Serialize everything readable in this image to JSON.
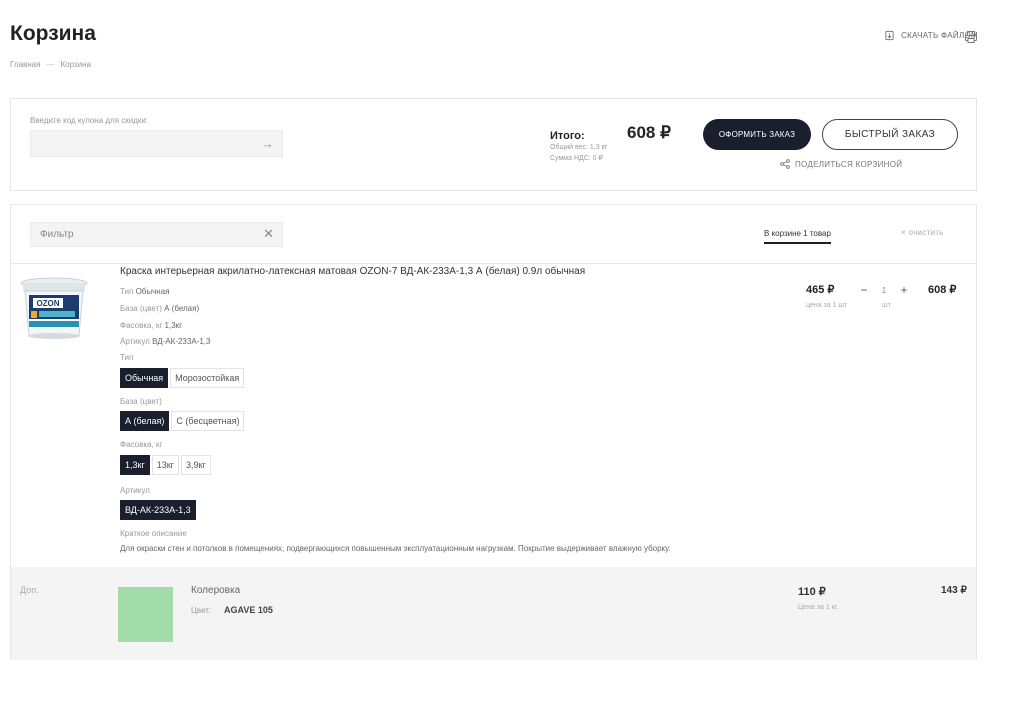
{
  "page": {
    "title": "Корзина",
    "breadcrumb": [
      "Главная",
      "Корзина"
    ],
    "breadcrumb_sep": "—",
    "download_label": "Скачать файлом"
  },
  "coupon": {
    "label": "Введите код купона для скидки:",
    "value": "",
    "arrow_icon": "arrow-right-icon"
  },
  "summary": {
    "total_label": "Итого:",
    "total_value": "608 ₽",
    "weight": "Общий вес: 1,3 кг",
    "vat": "Сумма НДС: 0 ₽",
    "order_button": "Оформить заказ",
    "quick_order_button": "Быстрый заказ",
    "share_label": "Поделиться корзиной"
  },
  "cart": {
    "filter_placeholder": "Фильтр",
    "count_label": "В корзине 1 товар",
    "clear_label": "× очистить",
    "clear_icon": "close-icon"
  },
  "product": {
    "name": "Краска интерьерная акрилатно-латексная матовая OZON-7 ВД-АК-233А-1,3 А (белая) 0.9л обычная",
    "brand_on_image": "OZON",
    "specs": [
      {
        "label": "Тип",
        "value": "Обычная"
      },
      {
        "label": "База (цвет)",
        "value": "А (белая)"
      },
      {
        "label": "Фасовка, кг",
        "value": "1,3кг"
      },
      {
        "label": "Артикул",
        "value": "ВД-АК-233А-1,3"
      }
    ],
    "options": [
      {
        "label": "Тип",
        "values": [
          "Обычная",
          "Морозостойкая"
        ],
        "selected": 0
      },
      {
        "label": "База (цвет)",
        "values": [
          "А (белая)",
          "С (бесцветная)"
        ],
        "selected": 0
      },
      {
        "label": "Фасовка, кг",
        "values": [
          "1,3кг",
          "13кг",
          "3,9кг"
        ],
        "selected": 0
      },
      {
        "label": "Артикул",
        "values": [
          "ВД-АК-233А-1,3"
        ],
        "selected": 0
      }
    ],
    "description_label": "Краткое описание",
    "description": "Для окраски стен и потолков в помещениях, подвергающихся повышенным эксплуатационным нагрузкам. Покрытие выдерживает влажную уборку.",
    "unit_price": "465 ₽",
    "unit_price_sub": "цена за 1 шт",
    "qty": "1",
    "qty_unit": "шт",
    "qty_minus": "−",
    "qty_plus": "+",
    "sum": "608 ₽"
  },
  "extra": {
    "label": "Доп.",
    "name": "Колеровка",
    "color_label": "Цвет:",
    "color_value": "AGAVE 105",
    "swatch_color": "#a3dcab",
    "price": "110 ₽",
    "price_sub": "Цена за 1 кг.",
    "sum": "143 ₽"
  },
  "colors": {
    "primary": "#1a1f2e",
    "border": "#e6e6e6"
  }
}
